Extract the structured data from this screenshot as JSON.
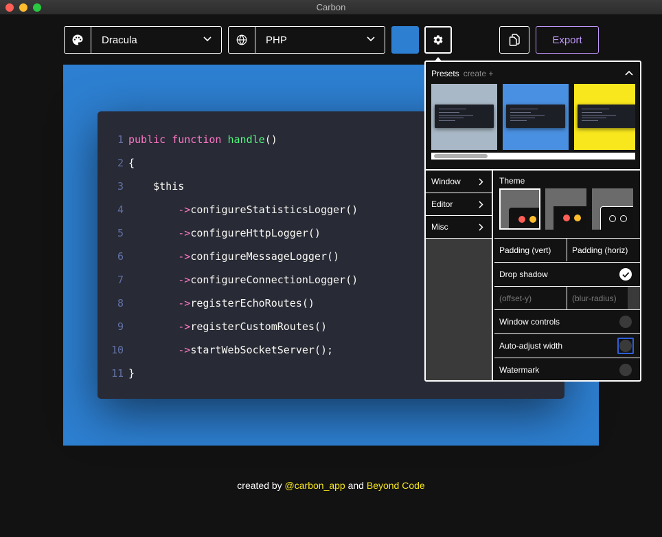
{
  "window": {
    "title": "Carbon"
  },
  "toolbar": {
    "theme_icon": "palette-icon",
    "theme_value": "Dracula",
    "language_icon": "globe-icon",
    "language_value": "PHP",
    "background_color": "#2d7fd1",
    "settings_icon": "gear-icon",
    "copy_icon": "copy-icon",
    "export_label": "Export"
  },
  "code": {
    "lines": [
      {
        "n": "1",
        "tokens": [
          [
            "public function ",
            "pink"
          ],
          [
            "handle",
            "green"
          ],
          [
            "()",
            "white"
          ]
        ]
      },
      {
        "n": "2",
        "tokens": [
          [
            "{",
            "white"
          ]
        ]
      },
      {
        "n": "3",
        "tokens": [
          [
            "    $this",
            "white"
          ]
        ]
      },
      {
        "n": "4",
        "tokens": [
          [
            "        ",
            "white"
          ],
          [
            "->",
            "pink"
          ],
          [
            "configureStatisticsLogger()",
            "white"
          ]
        ]
      },
      {
        "n": "5",
        "tokens": [
          [
            "        ",
            "white"
          ],
          [
            "->",
            "pink"
          ],
          [
            "configureHttpLogger()",
            "white"
          ]
        ]
      },
      {
        "n": "6",
        "tokens": [
          [
            "        ",
            "white"
          ],
          [
            "->",
            "pink"
          ],
          [
            "configureMessageLogger()",
            "white"
          ]
        ]
      },
      {
        "n": "7",
        "tokens": [
          [
            "        ",
            "white"
          ],
          [
            "->",
            "pink"
          ],
          [
            "configureConnectionLogger()",
            "white"
          ]
        ]
      },
      {
        "n": "8",
        "tokens": [
          [
            "        ",
            "white"
          ],
          [
            "->",
            "pink"
          ],
          [
            "registerEchoRoutes()",
            "white"
          ]
        ]
      },
      {
        "n": "9",
        "tokens": [
          [
            "        ",
            "white"
          ],
          [
            "->",
            "pink"
          ],
          [
            "registerCustomRoutes()",
            "white"
          ]
        ]
      },
      {
        "n": "10",
        "tokens": [
          [
            "        ",
            "white"
          ],
          [
            "->",
            "pink"
          ],
          [
            "startWebSocketServer();",
            "white"
          ]
        ]
      },
      {
        "n": "11",
        "tokens": [
          [
            "}",
            "white"
          ]
        ]
      }
    ]
  },
  "settings_panel": {
    "presets_label": "Presets",
    "create_label": "create +",
    "preset_colors": [
      "#a9b8c6",
      "#4a90e2",
      "#f8e71c"
    ],
    "menu": [
      "Window",
      "Editor",
      "Misc"
    ],
    "theme_label": "Theme",
    "padding_vert": "Padding (vert)",
    "padding_horiz": "Padding (horiz)",
    "drop_shadow": "Drop shadow",
    "offset_y": "(offset-y)",
    "blur_radius": "(blur-radius)",
    "window_controls": "Window controls",
    "auto_adjust": "Auto-adjust width",
    "watermark": "Watermark"
  },
  "footer": {
    "prefix": "created by ",
    "link1": "@carbon_app",
    "mid": " and ",
    "link2": "Beyond Code"
  },
  "colors": {
    "accent": "#c198fb",
    "pink": "#ff79c6",
    "green": "#50fa7b",
    "yellow": "#f8e71c",
    "editor_bg": "#282a36"
  }
}
